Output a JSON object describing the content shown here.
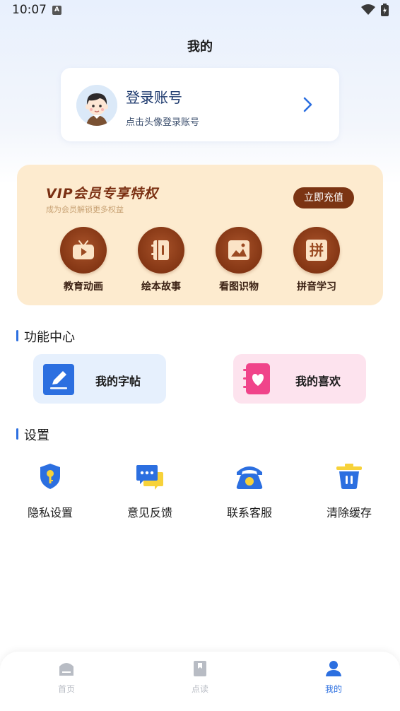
{
  "status": {
    "time": "10:07",
    "badge": "A"
  },
  "header": {
    "title": "我的"
  },
  "login": {
    "title": "登录账号",
    "subtitle": "点击头像登录账号"
  },
  "vip": {
    "title": "VIP会员专享特权",
    "subtitle": "成为会员解锁更多权益",
    "button": "立即充值",
    "items": [
      {
        "label": "教育动画",
        "icon": "tv-icon"
      },
      {
        "label": "绘本故事",
        "icon": "book-icon"
      },
      {
        "label": "看图识物",
        "icon": "picture-icon"
      },
      {
        "label": "拼音学习",
        "icon": "pinyin-icon",
        "glyph": "拼"
      }
    ]
  },
  "functions": {
    "title": "功能中心",
    "items": [
      {
        "label": "我的字帖",
        "icon": "pen-icon",
        "bg": "#e6f0fd"
      },
      {
        "label": "我的喜欢",
        "icon": "heart-notebook-icon",
        "bg": "#fde3ee"
      }
    ]
  },
  "settings": {
    "title": "设置",
    "items": [
      {
        "label": "隐私设置",
        "icon": "shield-key-icon"
      },
      {
        "label": "意见反馈",
        "icon": "chat-icon"
      },
      {
        "label": "联系客服",
        "icon": "phone-icon"
      },
      {
        "label": "清除缓存",
        "icon": "trash-icon"
      }
    ]
  },
  "nav": {
    "items": [
      {
        "label": "首页",
        "icon": "home-icon",
        "active": false
      },
      {
        "label": "点读",
        "icon": "book-read-icon",
        "active": false
      },
      {
        "label": "我的",
        "icon": "user-icon",
        "active": true
      }
    ]
  },
  "colors": {
    "accent": "#2c6fe0",
    "vip_brown": "#7b3413",
    "vip_bg": "#fdebcf",
    "nav_inactive": "#b8bcc4"
  }
}
